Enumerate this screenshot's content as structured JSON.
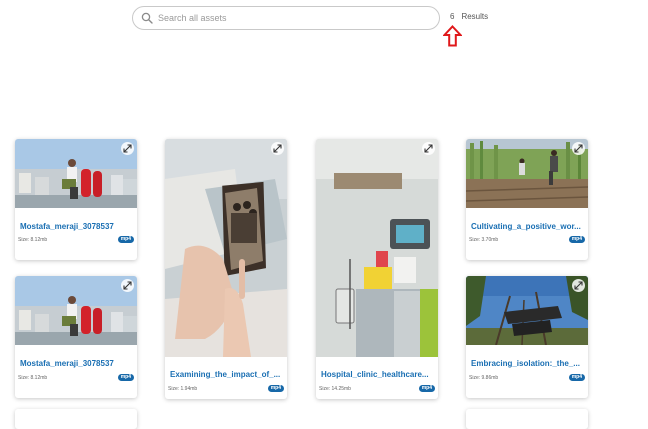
{
  "search": {
    "placeholder": "Search all assets",
    "value": ""
  },
  "results": {
    "count": "6",
    "label": "Results"
  },
  "annotation": {
    "color": "#e0181b",
    "icon": "up-arrow-outline"
  },
  "accent_color": "#1768a8",
  "assets": [
    {
      "title": "Mostafa_meraji_3078537",
      "size": "Size: 8.12mb",
      "type": "mp4"
    },
    {
      "title": "Examining_the_impact_of_...",
      "size": "Size: 1.94mb",
      "type": "mp4"
    },
    {
      "title": "Hospital_clinic_healthcare...",
      "size": "Size: 14.25mb",
      "type": "mp4"
    },
    {
      "title": "Cultivating_a_positive_wor...",
      "size": "Size: 3.70mb",
      "type": "mp4"
    },
    {
      "title": "Mostafa_meraji_3078537",
      "size": "Size: 8.12mb",
      "type": "mp4"
    },
    {
      "title": "Embracing_isolation:_the_...",
      "size": "Size: 9.86mb",
      "type": "mp4"
    }
  ]
}
